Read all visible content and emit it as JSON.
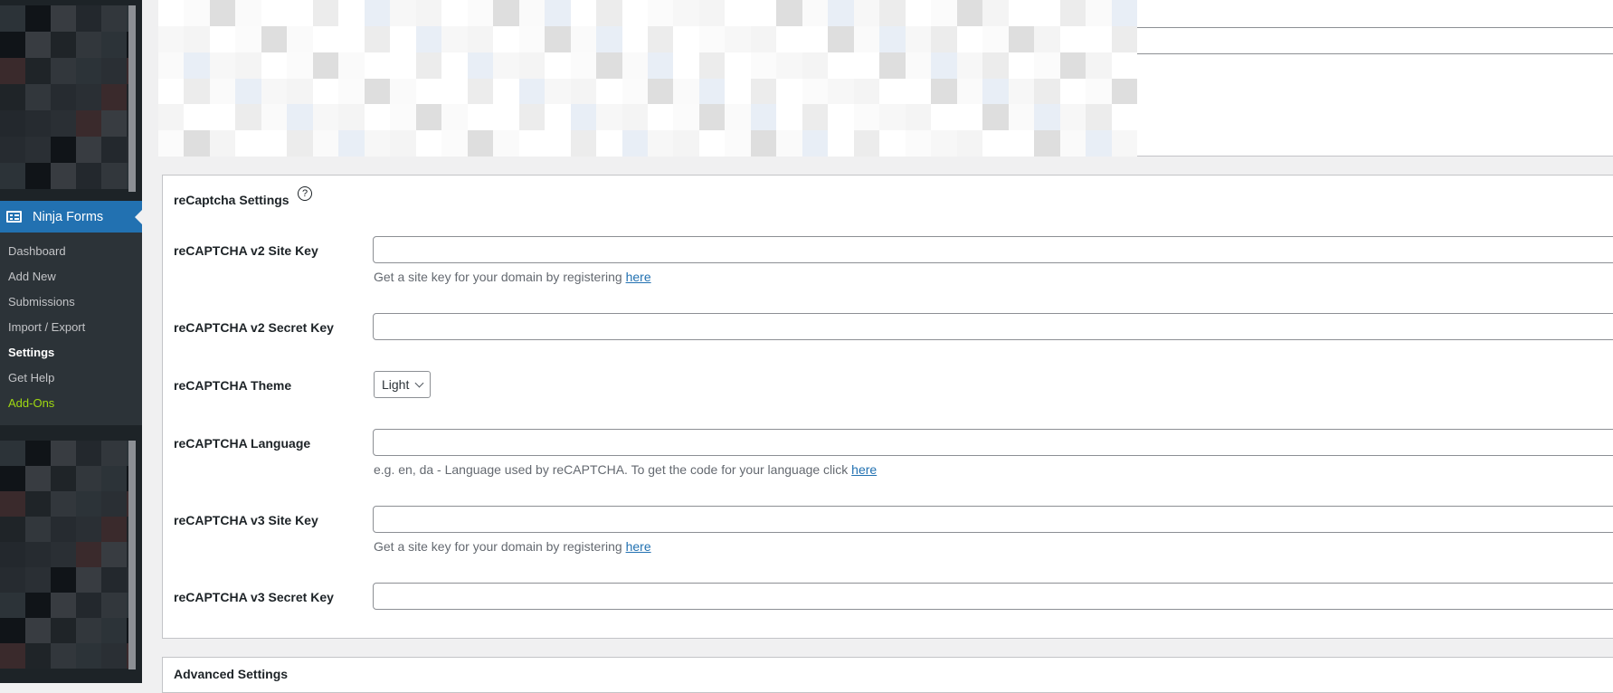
{
  "sidebar": {
    "active_menu": {
      "label": "Ninja Forms",
      "icon": "forms-icon"
    },
    "submenu": [
      {
        "label": "Dashboard",
        "state": "normal"
      },
      {
        "label": "Add New",
        "state": "normal"
      },
      {
        "label": "Submissions",
        "state": "normal"
      },
      {
        "label": "Import / Export",
        "state": "normal"
      },
      {
        "label": "Settings",
        "state": "current"
      },
      {
        "label": "Get Help",
        "state": "normal"
      },
      {
        "label": "Add-Ons",
        "state": "highlight"
      }
    ],
    "colors": {
      "background": "#1d2327",
      "submenu_bg": "#2c3338",
      "active_bg": "#2271b1",
      "addons_color": "#a0d911"
    }
  },
  "recaptcha_panel": {
    "title": "reCaptcha Settings",
    "help_icon": "?",
    "rows": [
      {
        "label": "reCAPTCHA v2 Site Key",
        "type": "text",
        "value": "",
        "description": "Get a site key for your domain by registering ",
        "link": "here"
      },
      {
        "label": "reCAPTCHA v2 Secret Key",
        "type": "text",
        "value": ""
      },
      {
        "label": "reCAPTCHA Theme",
        "type": "select",
        "value": "Light"
      },
      {
        "label": "reCAPTCHA Language",
        "type": "text",
        "value": "",
        "description": "e.g. en, da - Language used by reCAPTCHA. To get the code for your language click ",
        "link": "here"
      },
      {
        "label": "reCAPTCHA v3 Site Key",
        "type": "text",
        "value": "",
        "description": "Get a site key for your domain by registering ",
        "link": "here"
      },
      {
        "label": "reCAPTCHA v3 Secret Key",
        "type": "text",
        "value": ""
      }
    ]
  },
  "advanced_panel": {
    "title": "Advanced Settings"
  },
  "colors": {
    "link": "#2271b1",
    "page_bg": "#f0f0f1",
    "description": "#646970"
  }
}
